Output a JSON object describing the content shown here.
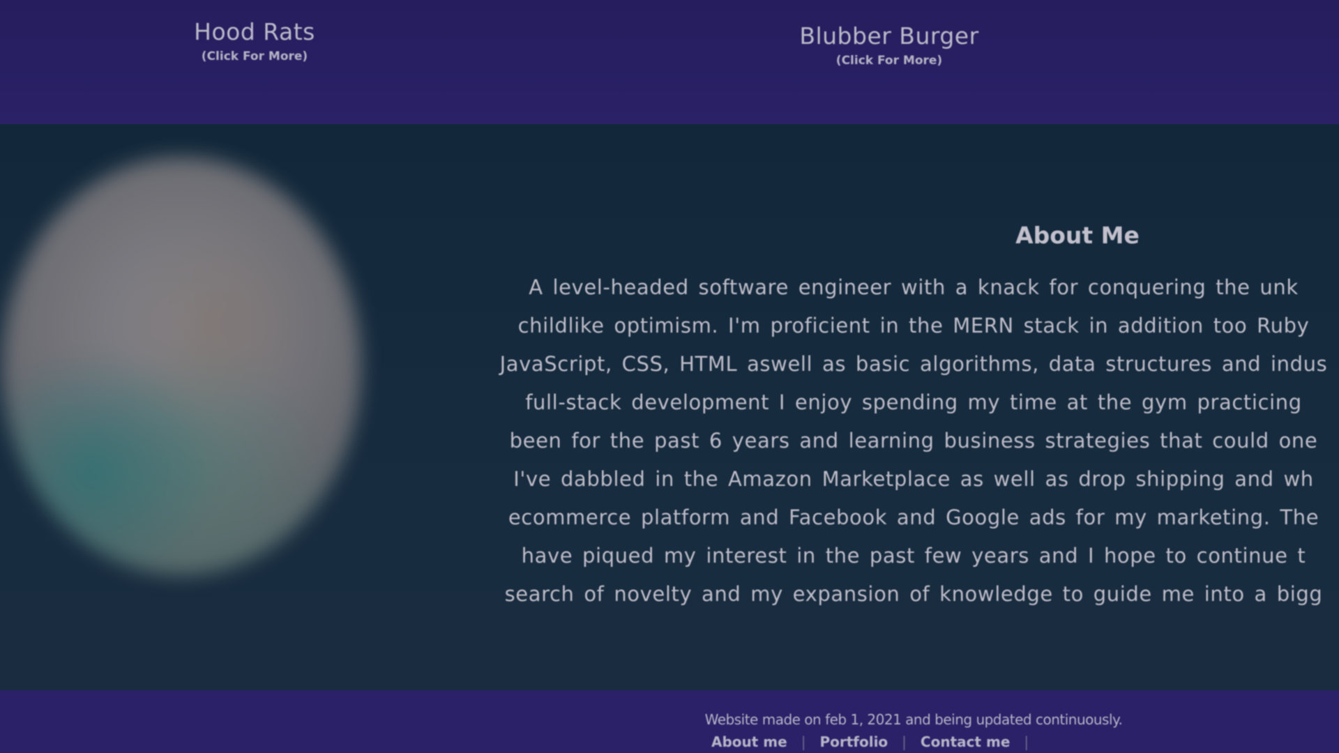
{
  "projects": [
    {
      "title": "Hood Rats",
      "subtitle": "(Click For More)"
    },
    {
      "title": "Blubber Burger",
      "subtitle": "(Click For More)"
    }
  ],
  "about": {
    "heading": "About Me",
    "lines": [
      "A level-headed software engineer with a knack for conquering the unk",
      "childlike optimism. I'm proficient in the MERN stack in addition too Ruby",
      "JavaScript, CSS, HTML aswell as basic algorithms, data structures and indus",
      "full-stack development I enjoy spending my time at the gym practicing",
      "been for the past 6 years and learning business strategies that could one",
      "I've dabbled in the Amazon Marketplace as well as drop shipping and wh",
      "ecommerce platform and Facebook and Google ads for my marketing. The",
      "have piqued my interest in the past few years and I hope to continue t",
      "search of novelty and my expansion of knowledge to guide me into a bigg"
    ]
  },
  "footer": {
    "note": "Website made on feb 1, 2021 and being updated continuously.",
    "links": [
      "About me",
      "Portfolio",
      "Contact me"
    ],
    "separator": "|"
  },
  "colors": {
    "nav_bg": "#2a2168",
    "about_bg": "#162b3e",
    "text": "#bebcc8"
  }
}
